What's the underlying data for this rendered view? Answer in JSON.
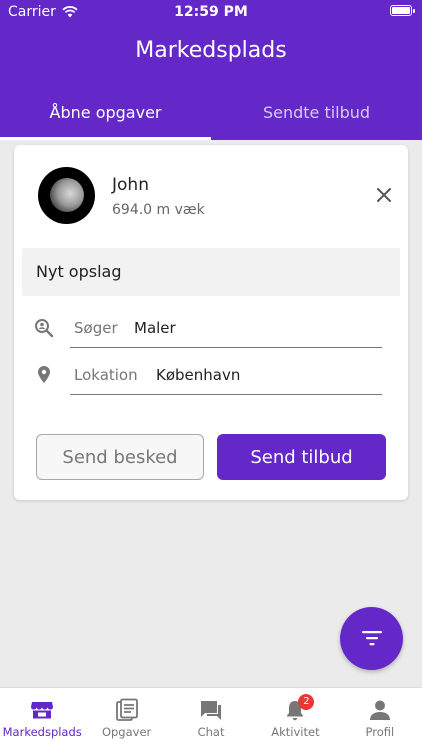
{
  "status_bar": {
    "carrier": "Carrier",
    "time": "12:59 PM"
  },
  "header": {
    "title": "Markedsplads",
    "tabs": [
      {
        "label": "Åbne opgaver",
        "active": true
      },
      {
        "label": "Sendte tilbud",
        "active": false
      }
    ]
  },
  "card": {
    "user_name": "John",
    "distance": "694.0 m væk",
    "post_title": "Nyt opslag",
    "fields": {
      "seeking": {
        "label": "Søger",
        "value": "Maler"
      },
      "location": {
        "label": "Lokation",
        "value": "København"
      }
    },
    "send_message_label": "Send besked",
    "send_offer_label": "Send tilbud"
  },
  "bottom_nav": {
    "items": [
      {
        "label": "Markedsplads",
        "icon": "store-icon",
        "active": true
      },
      {
        "label": "Opgaver",
        "icon": "tasks-icon",
        "active": false
      },
      {
        "label": "Chat",
        "icon": "chat-icon",
        "active": false
      },
      {
        "label": "Aktivitet",
        "icon": "bell-icon",
        "active": false,
        "badge": "2"
      },
      {
        "label": "Profil",
        "icon": "person-icon",
        "active": false
      }
    ]
  },
  "colors": {
    "primary": "#6427c8",
    "badge": "#e53935",
    "background": "#ebebeb"
  }
}
